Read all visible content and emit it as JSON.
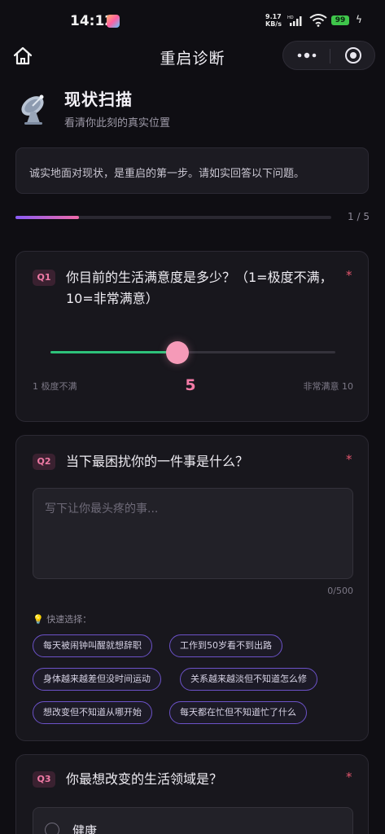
{
  "status": {
    "time": "14:12",
    "net_speed": "9.17",
    "net_unit": "KB/s",
    "net_type": "HD",
    "battery": "99"
  },
  "nav": {
    "title": "重启诊断",
    "home_icon": "home-icon",
    "more_icon": "more-dots-icon",
    "target_icon": "target-icon"
  },
  "header": {
    "icon": "satellite-dish-icon",
    "title": "现状扫描",
    "subtitle": "看清你此刻的真实位置"
  },
  "notice": "诚实地面对现状，是重启的第一步。请如实回答以下问题。",
  "progress": {
    "current": 1,
    "total": 5,
    "label": "1 / 5"
  },
  "questions": [
    {
      "badge": "Q1",
      "text": "你目前的生活满意度是多少？（1=极度不满，10=非常满意）",
      "required": "*",
      "slider": {
        "min": 1,
        "max": 10,
        "value": 5,
        "value_label": "5",
        "min_label": "1 极度不满",
        "max_label": "非常满意 10"
      }
    },
    {
      "badge": "Q2",
      "text": "当下最困扰你的一件事是什么？",
      "required": "*",
      "placeholder": "写下让你最头疼的事...",
      "counter": "0/500",
      "quick_label": "💡 快速选择：",
      "chips": [
        "每天被闹钟叫醒就想辞职",
        "工作到50岁看不到出路",
        "身体越来越差但没时间运动",
        "关系越来越淡但不知道怎么修",
        "想改变但不知道从哪开始",
        "每天都在忙但不知道忙了什么"
      ]
    },
    {
      "badge": "Q3",
      "text": "你最想改变的生活领域是？",
      "required": "*",
      "options": [
        "健康"
      ]
    }
  ],
  "colors": {
    "accent_pink": "#f59ab8",
    "accent_green": "#2ec27a",
    "accent_purple": "#6c52c8",
    "required_red": "#e2556d"
  }
}
